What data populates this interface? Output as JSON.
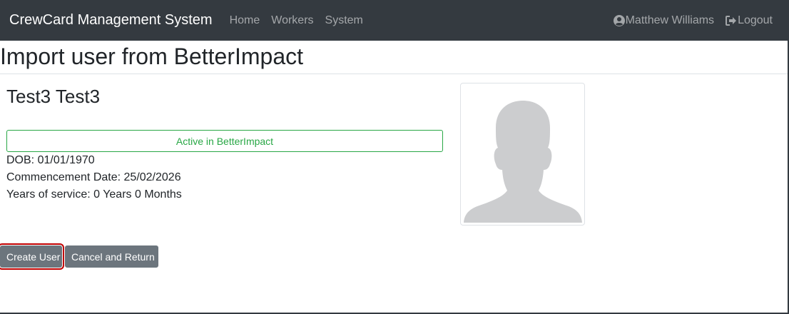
{
  "navbar": {
    "brand": "CrewCard Management System",
    "links": [
      "Home",
      "Workers",
      "System"
    ],
    "user": "Matthew Williams",
    "logout": "Logout",
    "user_icon": "user-circle-icon",
    "logout_icon": "sign-out-icon"
  },
  "page": {
    "title": "Import user from BetterImpact"
  },
  "profile": {
    "name": "Test3 Test3",
    "status": "Active in BetterImpact",
    "status_color": "#28a745",
    "dob_label": "DOB:",
    "dob": "01/01/1970",
    "commencement_label": "Commencement Date:",
    "commencement": "25/02/2026",
    "service_label": "Years of service:",
    "service": "0 Years 0 Months",
    "photo_icon": "placeholder-avatar-icon"
  },
  "actions": {
    "create": "Create User",
    "cancel": "Cancel and Return"
  }
}
